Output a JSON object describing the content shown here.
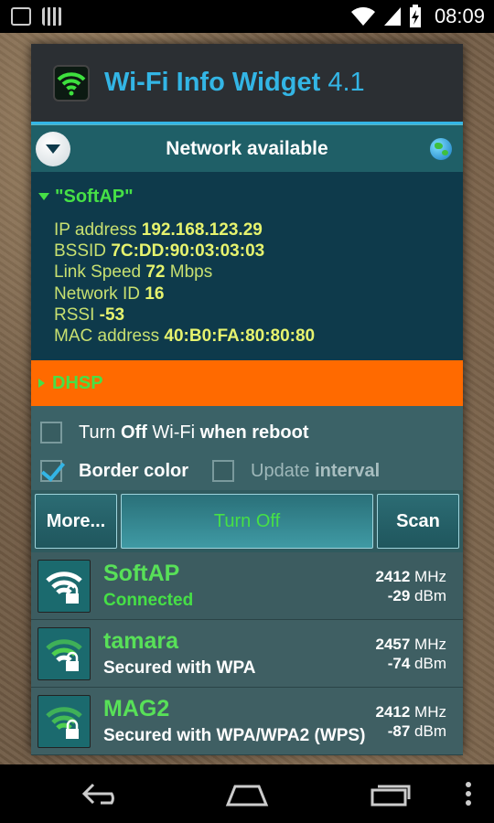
{
  "status_bar": {
    "time": "08:09",
    "icons": [
      "notification-icon",
      "barcode-icon",
      "wifi-icon",
      "signal-icon",
      "battery-charging-icon"
    ]
  },
  "header": {
    "title": "Wi-Fi Info Widget",
    "version": "4.1",
    "icon": "wifi-app-icon"
  },
  "network": {
    "state": "Network available",
    "ssid": "\"SoftAP\"",
    "details": [
      {
        "label": "IP address",
        "value": "192.168.123.29",
        "unit": ""
      },
      {
        "label": "BSSID",
        "value": "7C:DD:90:03:03:03",
        "unit": ""
      },
      {
        "label": "Link Speed",
        "value": "72",
        "unit": "Mbps"
      },
      {
        "label": "Network ID",
        "value": "16",
        "unit": ""
      },
      {
        "label": "RSSI",
        "value": "-53",
        "unit": ""
      },
      {
        "label": "MAC address",
        "value": "40:B0:FA:80:80:80",
        "unit": ""
      }
    ],
    "dhsp_label": "DHSP"
  },
  "options": {
    "reboot": {
      "pre": "Turn ",
      "bold": "Off",
      "mid": " Wi-Fi ",
      "bold2": "when reboot",
      "checked": false
    },
    "border_color": {
      "label": "Border color",
      "checked": true
    },
    "update_interval": {
      "pre": "Update ",
      "bold": "interval",
      "checked": false
    }
  },
  "buttons": {
    "more": "More...",
    "turn_off": "Turn Off",
    "scan": "Scan"
  },
  "networks": [
    {
      "name": "SoftAP",
      "status": "Connected",
      "freq": "2412",
      "freq_unit": "MHz",
      "dbm": "-29",
      "dbm_unit": "dBm",
      "connected": true
    },
    {
      "name": "tamara",
      "status": "Secured with WPA",
      "freq": "2457",
      "freq_unit": "MHz",
      "dbm": "-74",
      "dbm_unit": "dBm",
      "connected": false
    },
    {
      "name": "MAG2",
      "status": "Secured with WPA/WPA2 (WPS)",
      "freq": "2412",
      "freq_unit": "MHz",
      "dbm": "-87",
      "dbm_unit": "dBm",
      "connected": false
    }
  ],
  "colors": {
    "accent": "#33b5e5",
    "green": "#46e046",
    "orange": "#ff6a00",
    "teal": "#1f5f67"
  }
}
